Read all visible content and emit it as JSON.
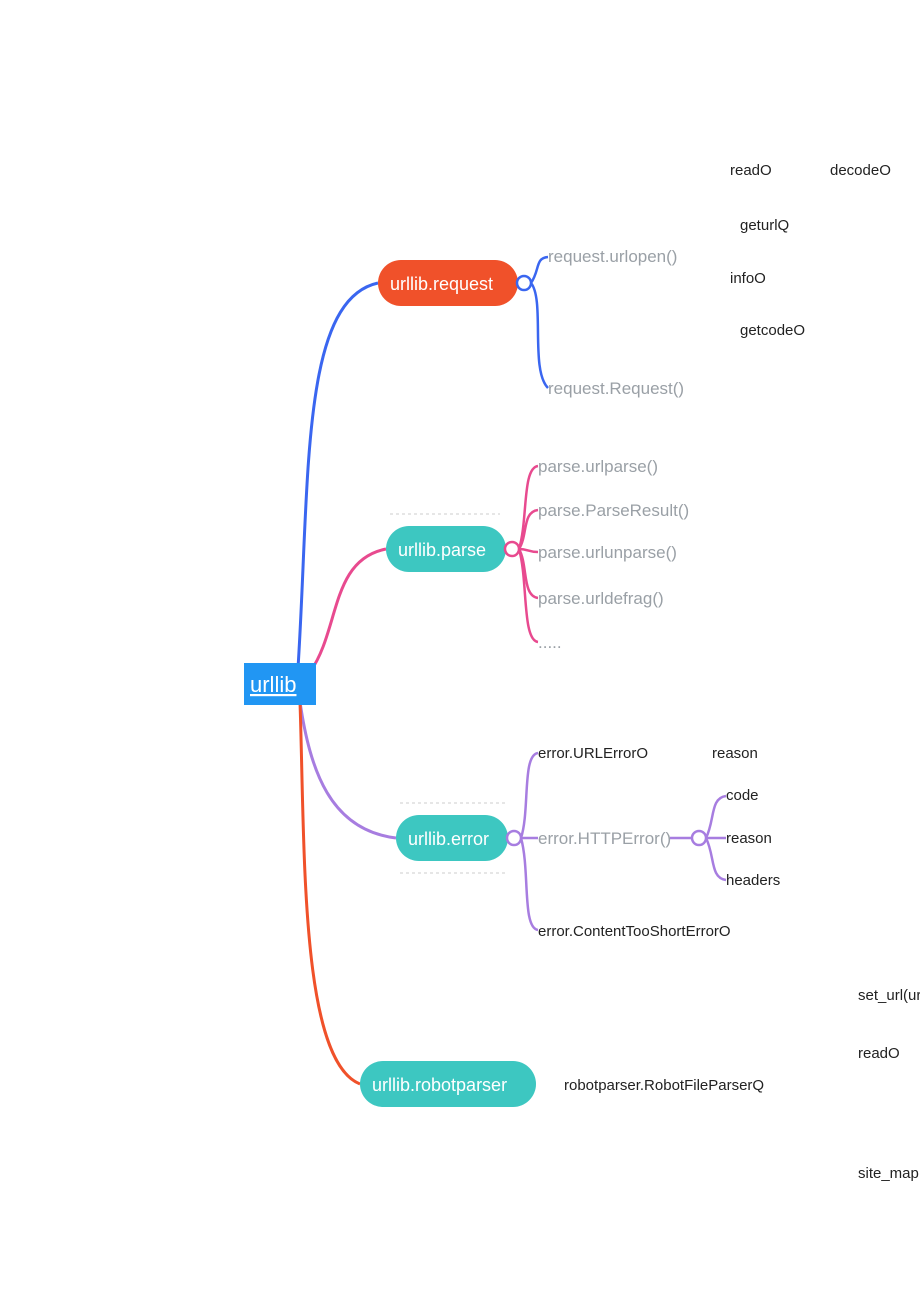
{
  "root": {
    "label": "urllib"
  },
  "branches": {
    "request": {
      "label": "urllib.request",
      "children": [
        {
          "label": "request.urlopen()"
        },
        {
          "label": "request.Request()"
        }
      ],
      "urlopen_methods": [
        "readO",
        "decodeO",
        "geturlQ",
        "infoO",
        "getcodeO"
      ]
    },
    "parse": {
      "label": "urllib.parse",
      "children": [
        {
          "label": "parse.urlparse()"
        },
        {
          "label": "parse.ParseResult()"
        },
        {
          "label": "parse.urlunparse()"
        },
        {
          "label": "parse.urldefrag()"
        },
        {
          "label": "....."
        }
      ]
    },
    "error": {
      "label": "urllib.error",
      "children": [
        {
          "label": "error.URLErrorO",
          "attrs": [
            "reason"
          ]
        },
        {
          "label": "error.HTTPError()",
          "attrs": [
            "code",
            "reason",
            "headers"
          ]
        },
        {
          "label": "error.ContentTooShortErrorO"
        }
      ]
    },
    "robotparser": {
      "label": "urllib.robotparser",
      "child": "robotparser.RobotFileParserQ",
      "methods": [
        "set_url(ur",
        "readO",
        "site_map"
      ]
    }
  },
  "colors": {
    "blue": "#3a66f0",
    "pink": "#e84a8f",
    "purple": "#a77de0",
    "orange": "#f0512a",
    "teal": "#3dc7c1",
    "root": "#2196f3"
  }
}
